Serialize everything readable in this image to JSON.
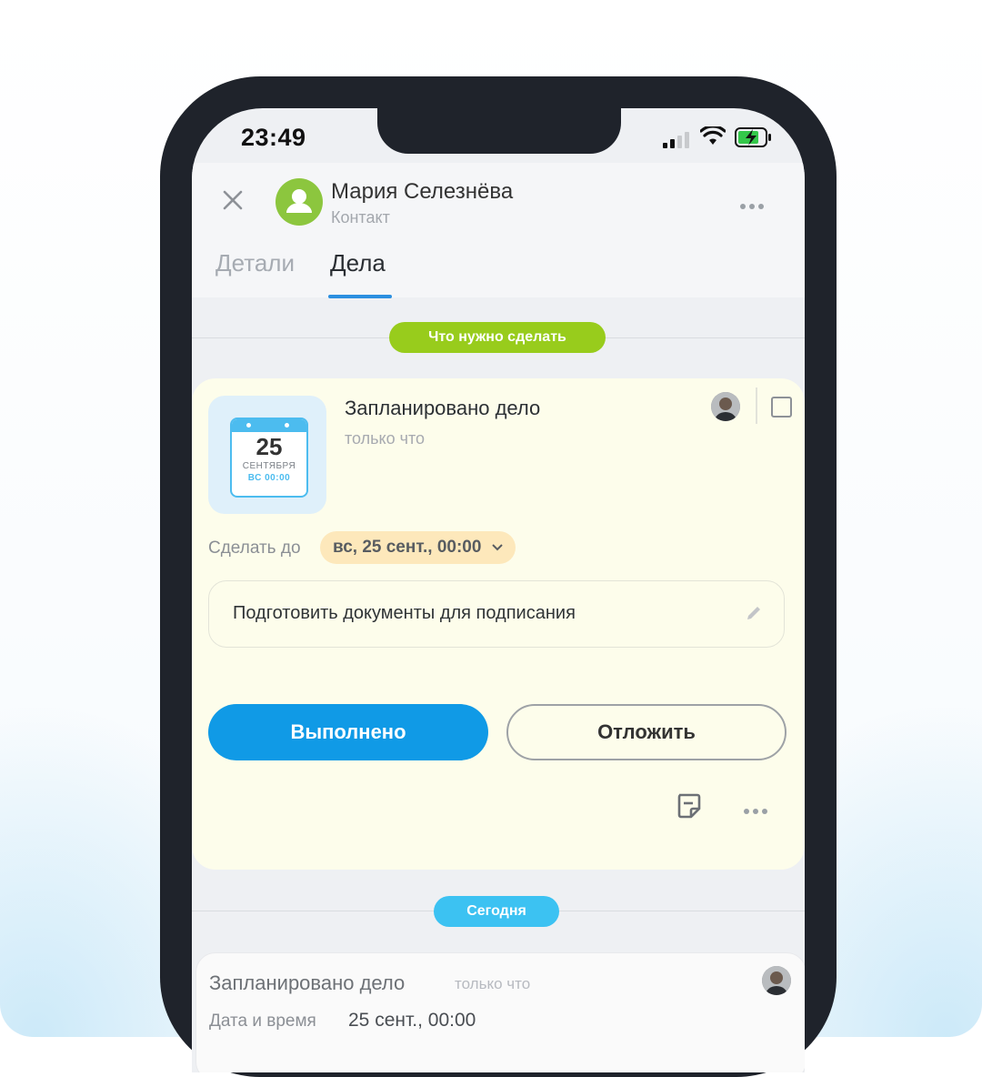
{
  "status_bar": {
    "time": "23:49"
  },
  "header": {
    "contact_name": "Мария Селезнёва",
    "contact_type": "Контакт",
    "tabs": [
      {
        "label": "Детали",
        "active": false
      },
      {
        "label": "Дела",
        "active": true
      }
    ]
  },
  "sections": {
    "todo_label": "Что нужно сделать",
    "today_label": "Сегодня"
  },
  "activity_card": {
    "calendar": {
      "day": "25",
      "month": "СЕНТЯБРЯ",
      "time": "ВС 00:00"
    },
    "title": "Запланировано дело",
    "subtitle": "только что",
    "due_label": "Сделать до",
    "due_value": "вс, 25 сент., 00:00",
    "description": "Подготовить документы для подписания",
    "done_button": "Выполнено",
    "postpone_button": "Отложить"
  },
  "today_card": {
    "title": "Запланировано дело",
    "time": "только что",
    "date_label": "Дата и время",
    "date_value": "25 сент., 00:00"
  },
  "colors": {
    "accent_blue": "#109ae6",
    "todo_green": "#98cc1c",
    "today_blue": "#3cc2f2",
    "card_bg": "#fdfdeb",
    "due_chip_bg": "#fde8bb",
    "avatar_green": "#8cc63e"
  }
}
